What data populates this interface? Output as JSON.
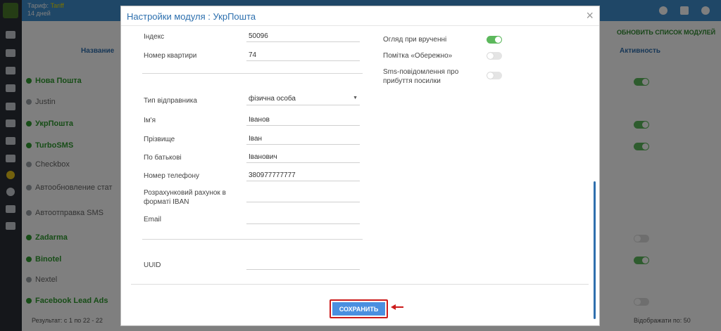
{
  "topbar": {
    "line1_prefix": "Тариф:",
    "line1_accent": "Tariff",
    "line2": "14 дней"
  },
  "background": {
    "update_button": "ОБНОВИТЬ СПИСОК МОДУЛЕЙ",
    "column_name": "Название",
    "column_active": "Активность",
    "rows": [
      {
        "label": "Нова Пошта",
        "state": "on"
      },
      {
        "label": "Justin",
        "state": "off"
      },
      {
        "label": "УкрПошта",
        "state": "on"
      },
      {
        "label": "TurboSMS",
        "state": "on"
      },
      {
        "label": "Checkbox",
        "state": "off"
      },
      {
        "label": "Автообновление стат",
        "state": "off"
      },
      {
        "label": "Автоотправка SMS",
        "state": "off"
      },
      {
        "label": "Zadarma",
        "state": "on"
      },
      {
        "label": "Binotel",
        "state": "on"
      },
      {
        "label": "Nextel",
        "state": "off"
      },
      {
        "label": "Facebook Lead Ads",
        "state": "on"
      }
    ],
    "footer_left": "Результат: с 1 по 22 - 22",
    "footer_right": "Відображати по: 50"
  },
  "modal": {
    "title": "Настройки модуля : УкрПошта",
    "close": "×",
    "fields": {
      "index_label": "Індекс",
      "index_value": "50096",
      "apartment_label": "Номер квартири",
      "apartment_value": "74",
      "sender_type_label": "Тип відправника",
      "sender_type_value": "фізична особа",
      "first_name_label": "Ім'я",
      "first_name_value": "Іванов",
      "last_name_label": "Прізвище",
      "last_name_value": "Іван",
      "patronymic_label": "По батькові",
      "patronymic_value": "Іванович",
      "phone_label": "Номер телефону",
      "phone_value": "380977777777",
      "iban_label": "Розрахунковий рахунок в форматі IBAN",
      "iban_value": "",
      "email_label": "Email",
      "email_value": "",
      "uuid_label": "UUID",
      "uuid_value": ""
    },
    "toggles": [
      {
        "label": "Огляд при врученні",
        "state": "on"
      },
      {
        "label": "Помітка «Обережно»",
        "state": "off"
      },
      {
        "label": "Sms-повідомлення про прибуття посилки",
        "state": "off"
      }
    ],
    "save_label": "СОХРАНИТЬ"
  },
  "colors": {
    "accent": "#2c6fae",
    "save": "#4a8fe0",
    "highlight": "#cc1b1b",
    "toggle_on": "#5cb85c"
  }
}
